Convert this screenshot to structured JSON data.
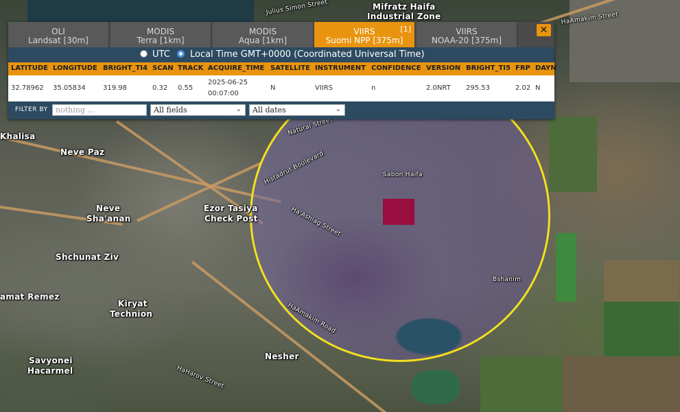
{
  "tabs": [
    {
      "line1": "OLI",
      "line2": "Landsat [30m]",
      "active": false,
      "count": ""
    },
    {
      "line1": "MODIS",
      "line2": "Terra [1km]",
      "active": false,
      "count": ""
    },
    {
      "line1": "MODIS",
      "line2": "Aqua [1km]",
      "active": false,
      "count": ""
    },
    {
      "line1": "VIIRS",
      "line2": "Suomi NPP [375m]",
      "active": true,
      "count": "[1]"
    },
    {
      "line1": "VIIRS",
      "line2": "NOAA-20 [375m]",
      "active": false,
      "count": ""
    }
  ],
  "close_label": "✕",
  "time": {
    "utc_label": "UTC",
    "local_label": "Local Time GMT+0000 (Coordinated Universal Time)",
    "selected": "local"
  },
  "table": {
    "headers": [
      "LATITUDE",
      "LONGITUDE",
      "BRIGHT_TI4",
      "SCAN",
      "TRACK",
      "ACQUIRE_TIME",
      "SATELLITE",
      "INSTRUMENT",
      "CONFIDENCE",
      "VERSION",
      "BRIGHT_TI5",
      "FRP",
      "DAYN"
    ],
    "row": {
      "latitude": "32.78962",
      "longitude": "35.05834",
      "bright_ti4": "319.98",
      "scan": "0.32",
      "track": "0.55",
      "acquire_date": "2025-06-25",
      "acquire_time": "00:07:00",
      "satellite": "N",
      "instrument": "VIIRS",
      "confidence": "n",
      "version": "2.0NRT",
      "bright_ti5": "295.53",
      "frp": "2.02",
      "daynight": "N"
    }
  },
  "filter": {
    "label": "FILTER BY",
    "placeholder": "nothing ...",
    "field_select": "All fields",
    "date_select": "All dates"
  },
  "map_labels": {
    "julius_simon": "Julius Simon Street",
    "mifratz": "Mifratz Haifa",
    "industrial": "Industrial Zone",
    "amakim": "HaAmakim Street",
    "khalisa": "Khalisa",
    "neve_paz": "Neve Paz",
    "neve": "Neve",
    "shaanan": "Sha'anan",
    "ezor": "Ezor Tasiya",
    "checkpost": "Check Post",
    "shchunat": "Shchunat Ziv",
    "ramat_remez": "amat Remez",
    "kiryat": "Kiryat",
    "technion": "Technion",
    "savyonei": "Savyonei",
    "hacarmel": "Hacarmel",
    "nesher": "Nesher",
    "sabon_haifa": "Sabon Haifa",
    "histadrut": "Histadrut Boulevard",
    "haahlag": "Ha'Ashlag Street",
    "haamakim_road": "HaAmakim Road",
    "bshanim": "Bshanim",
    "naturai": "Naturai Street",
    "haharov": "HaHarov Street"
  },
  "colors": {
    "accent": "#e8940e",
    "panel": "#2c4a60",
    "circle": "#f2e01e",
    "hotspot": "#9c0838"
  }
}
